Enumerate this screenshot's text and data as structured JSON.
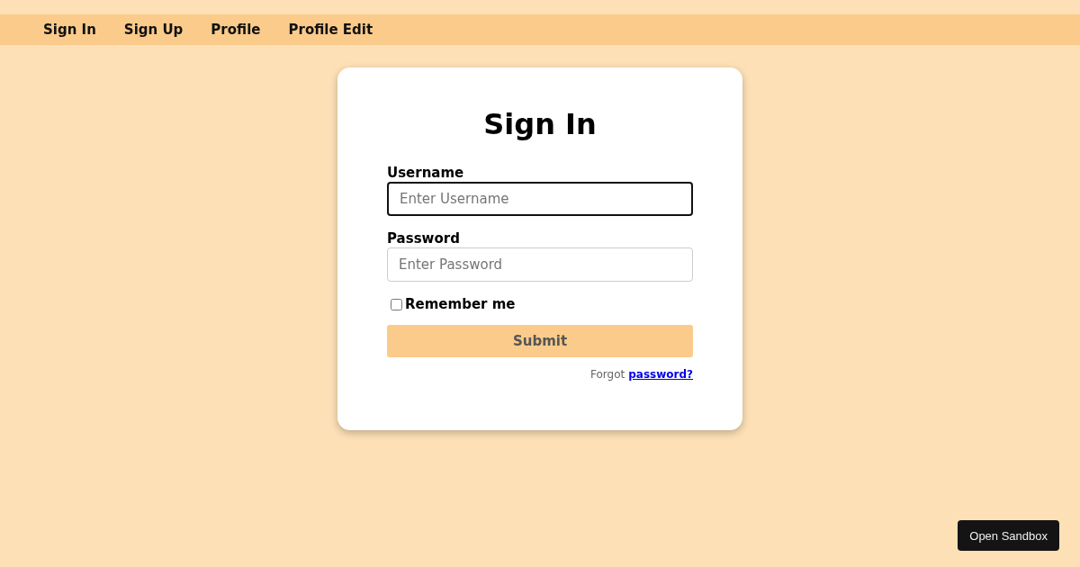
{
  "nav": {
    "links": [
      "Sign In",
      "Sign Up",
      "Profile",
      "Profile Edit"
    ]
  },
  "form": {
    "title": "Sign In",
    "fields": [
      {
        "label": "Username",
        "placeholder": "Enter Username",
        "focused": true
      },
      {
        "label": "Password",
        "placeholder": "Enter Password",
        "focused": false
      }
    ],
    "remember": {
      "label": "Remember me",
      "checked": false
    },
    "submit": "Submit",
    "forgot": {
      "text": "Forgot",
      "link": "password?"
    }
  },
  "sandbox_button": "Open Sandbox"
}
